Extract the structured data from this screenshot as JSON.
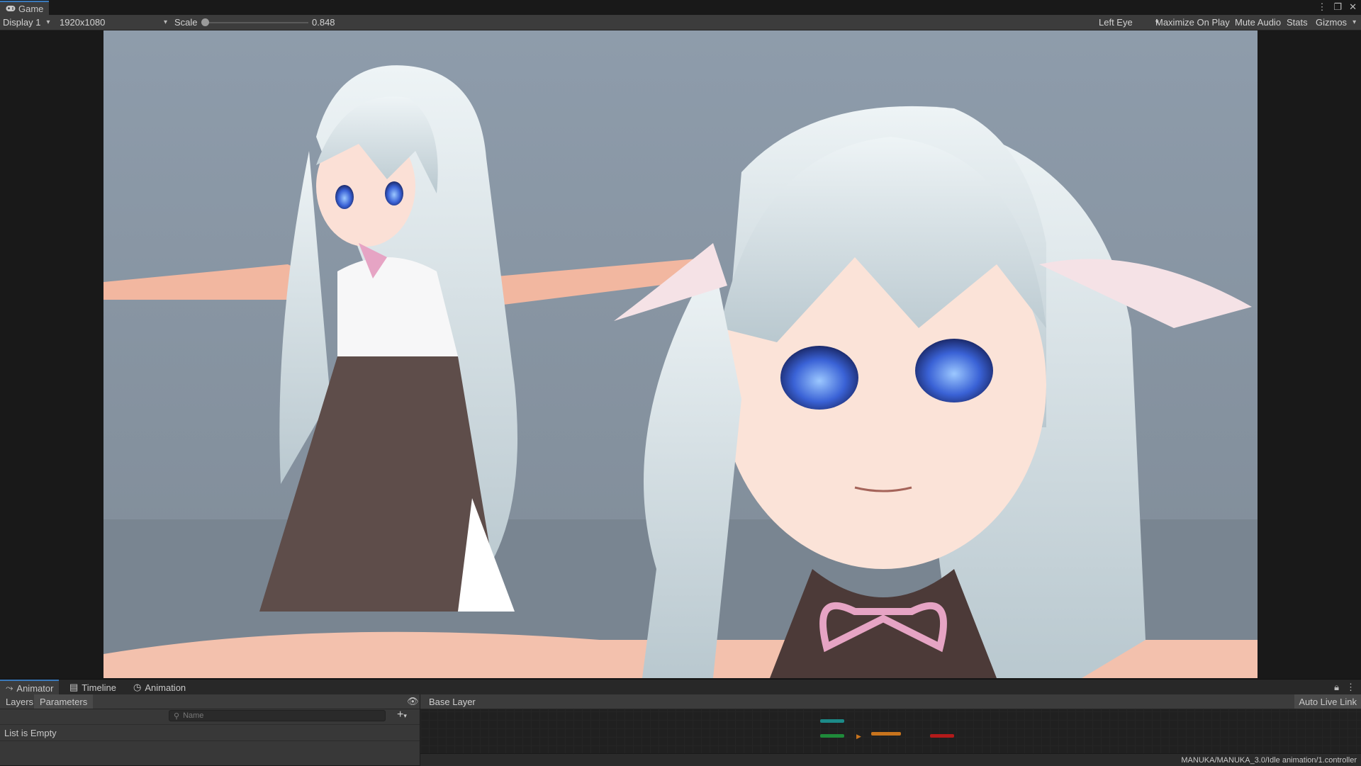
{
  "window": {
    "tab_label": "Game",
    "icons": [
      "kebab-menu-icon",
      "maximize-icon",
      "close-icon"
    ]
  },
  "toolbar": {
    "display": "Display 1",
    "resolution": "1920x1080",
    "scale_label": "Scale",
    "scale_value": "0.848",
    "scale_fraction": 0.0,
    "eye": "Left Eye",
    "maximize_on_play": "Maximize On Play",
    "mute_audio": "Mute Audio",
    "stats": "Stats",
    "gizmos": "Gizmos"
  },
  "bottom_tabs": [
    {
      "label": "Animator",
      "icon": "animator-icon"
    },
    {
      "label": "Timeline",
      "icon": "timeline-icon"
    },
    {
      "label": "Animation",
      "icon": "animation-clock-icon"
    }
  ],
  "animator": {
    "subtabs": [
      "Layers",
      "Parameters"
    ],
    "search_placeholder": "Name",
    "empty_message": "List is Empty",
    "breadcrumb": "Base Layer",
    "auto_live_link": "Auto Live Link",
    "controller_path": "MANUKA/MANUKA_3.0/Idle animation/1.controller"
  },
  "colors": {
    "accent": "#3a79bb",
    "panel": "#3c3c3c",
    "background": "#191919",
    "scene_backdrop": "#8d9aa8",
    "node_entry": "#1f8a3a",
    "node_default": "#c8741d",
    "node_exit": "#b31a1a",
    "node_any": "#1c8a88"
  }
}
